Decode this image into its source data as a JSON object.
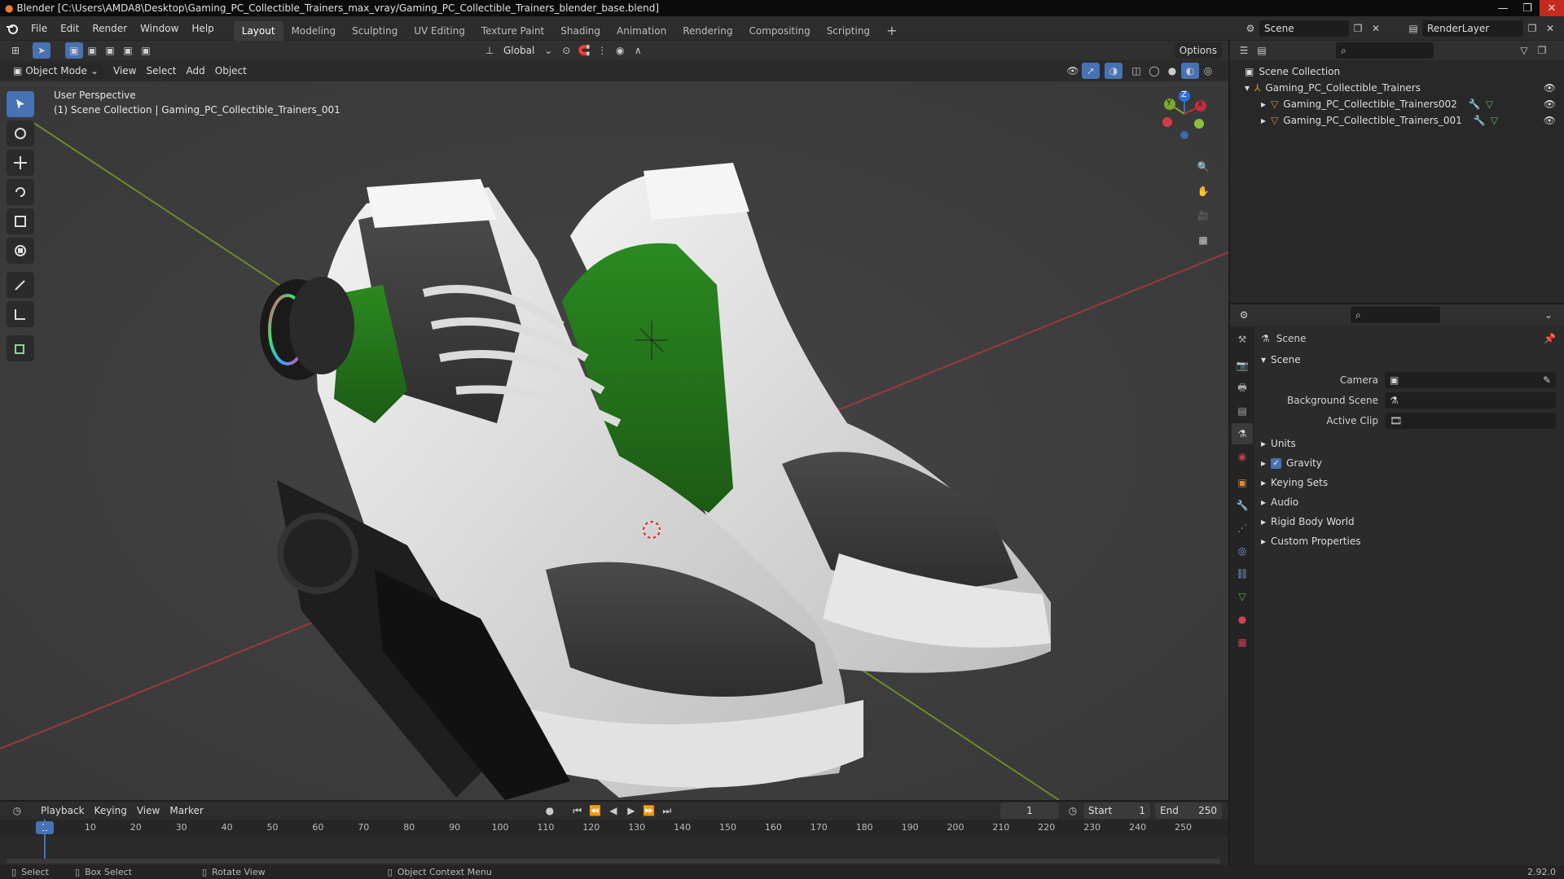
{
  "window": {
    "title": "Blender [C:\\Users\\AMDA8\\Desktop\\Gaming_PC_Collectible_Trainers_max_vray/Gaming_PC_Collectible_Trainers_blender_base.blend]"
  },
  "menu": [
    "File",
    "Edit",
    "Render",
    "Window",
    "Help"
  ],
  "workspaces": [
    "Layout",
    "Modeling",
    "Sculpting",
    "UV Editing",
    "Texture Paint",
    "Shading",
    "Animation",
    "Rendering",
    "Compositing",
    "Scripting"
  ],
  "workspace_active": "Layout",
  "scene_field": "Scene",
  "renderlayer_field": "RenderLayer",
  "viewport_header": {
    "mode": "Object Mode",
    "menus": [
      "View",
      "Select",
      "Add",
      "Object"
    ],
    "transform_orientation": "Global",
    "options": "Options"
  },
  "viewport": {
    "view_name": "User Perspective",
    "context": "(1) Scene Collection | Gaming_PC_Collectible_Trainers_001",
    "gizmo": {
      "x": "X",
      "y": "Y",
      "z": "Z"
    }
  },
  "outliner": {
    "root": "Scene Collection",
    "collection": "Gaming_PC_Collectible_Trainers",
    "objects": [
      "Gaming_PC_Collectible_Trainers002",
      "Gaming_PC_Collectible_Trainers_001"
    ]
  },
  "properties": {
    "header": "Scene",
    "panel": "Scene",
    "fields": [
      {
        "label": "Camera"
      },
      {
        "label": "Background Scene"
      },
      {
        "label": "Active Clip"
      }
    ],
    "subpanels": [
      "Units",
      "Gravity",
      "Keying Sets",
      "Audio",
      "Rigid Body World",
      "Custom Properties"
    ],
    "gravity_checked": true
  },
  "timeline": {
    "menus": [
      "Playback",
      "Keying",
      "View",
      "Marker"
    ],
    "current_frame": "1",
    "start_label": "Start",
    "start": "1",
    "end_label": "End",
    "end": "250",
    "ticks": [
      "10",
      "20",
      "30",
      "40",
      "50",
      "60",
      "70",
      "80",
      "90",
      "100",
      "110",
      "120",
      "130",
      "140",
      "150",
      "160",
      "170",
      "180",
      "190",
      "200",
      "210",
      "220",
      "230",
      "240",
      "250"
    ],
    "playhead": "1"
  },
  "statusbar": {
    "select": "Select",
    "box_select": "Box Select",
    "rotate_view": "Rotate View",
    "context_menu": "Object Context Menu",
    "version": "2.92.0"
  },
  "colors": {
    "accent": "#4772b3",
    "shoe_green": "#2f7a1f",
    "axis_x": "#c0303a",
    "axis_y": "#7aa82a",
    "axis_z": "#2e6fd8"
  }
}
